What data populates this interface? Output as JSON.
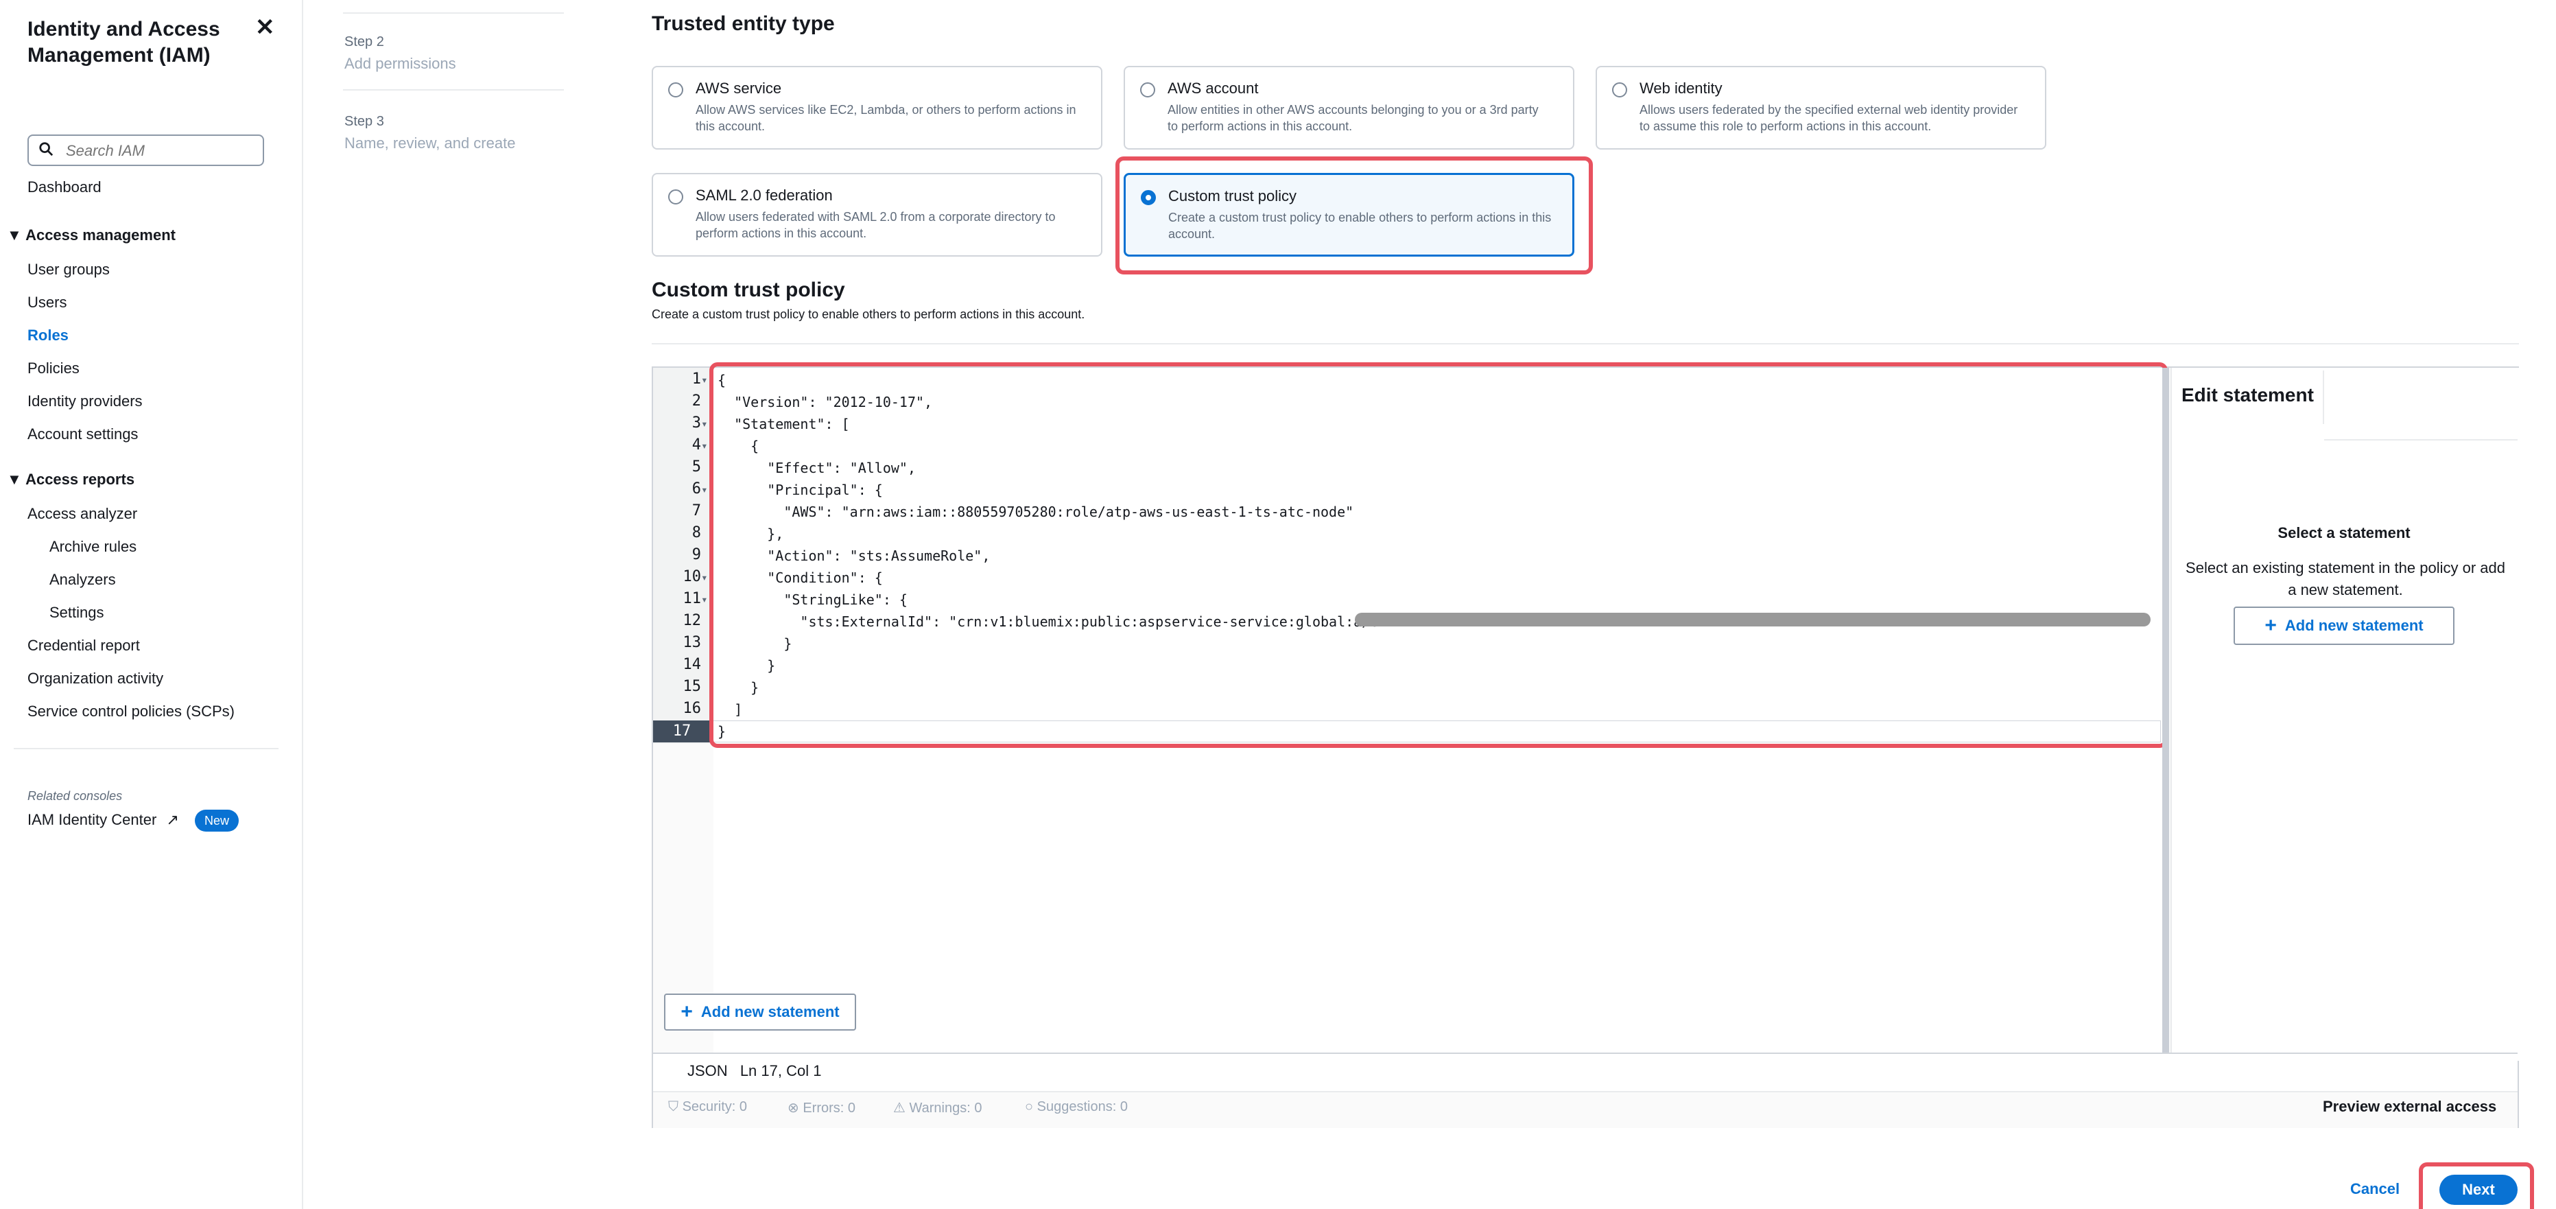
{
  "sidebar": {
    "title": "Identity and Access Management (IAM)",
    "close_icon": "close-icon",
    "search_placeholder": "Search IAM",
    "dashboard": "Dashboard",
    "access_management": {
      "label": "Access management",
      "items": [
        "User groups",
        "Users",
        "Roles",
        "Policies",
        "Identity providers",
        "Account settings"
      ],
      "active": "Roles"
    },
    "access_reports": {
      "label": "Access reports",
      "analyzer": "Access analyzer",
      "analyzer_items": [
        "Archive rules",
        "Analyzers",
        "Settings"
      ],
      "items": [
        "Credential report",
        "Organization activity",
        "Service control policies (SCPs)"
      ]
    },
    "related_consoles": "Related consoles",
    "identity_center": "IAM Identity Center",
    "new_badge": "New"
  },
  "steps": [
    {
      "label": "Step 2",
      "text": "Add permissions"
    },
    {
      "label": "Step 3",
      "text": "Name, review, and create"
    }
  ],
  "trusted_entity": {
    "heading": "Trusted entity type",
    "options": [
      {
        "title": "AWS service",
        "desc": "Allow AWS services like EC2, Lambda, or others to perform actions in this account."
      },
      {
        "title": "AWS account",
        "desc": "Allow entities in other AWS accounts belonging to you or a 3rd party to perform actions in this account."
      },
      {
        "title": "Web identity",
        "desc": "Allows users federated by the specified external web identity provider to assume this role to perform actions in this account."
      },
      {
        "title": "SAML 2.0 federation",
        "desc": "Allow users federated with SAML 2.0 from a corporate directory to perform actions in this account."
      },
      {
        "title": "Custom trust policy",
        "desc": "Create a custom trust policy to enable others to perform actions in this account."
      }
    ],
    "selected": "Custom trust policy"
  },
  "policy": {
    "heading": "Custom trust policy",
    "description": "Create a custom trust policy to enable others to perform actions in this account.",
    "code_lines": [
      "{",
      "  \"Version\": \"2012-10-17\",",
      "  \"Statement\": [",
      "    {",
      "      \"Effect\": \"Allow\",",
      "      \"Principal\": {",
      "        \"AWS\": \"arn:aws:iam::880559705280:role/atp-aws-us-east-1-ts-atc-node\"",
      "      },",
      "      \"Action\": \"sts:AssumeRole\",",
      "      \"Condition\": {",
      "        \"StringLike\": {",
      "          \"sts:ExternalId\": \"crn:v1:bluemix:public:aspservice-service:global:a/e7",
      "        }",
      "      }",
      "    }",
      "  ]",
      "}"
    ],
    "line_numbers": [
      "1",
      "2",
      "3",
      "4",
      "5",
      "6",
      "7",
      "8",
      "9",
      "10",
      "11",
      "12",
      "13",
      "14",
      "15",
      "16",
      "17"
    ],
    "current_line": "17",
    "edit_statement": "Edit statement",
    "select_statement_title": "Select a statement",
    "select_statement_desc": "Select an existing statement in the policy or add a new statement.",
    "add_new_statement": "Add new statement",
    "status_format": "JSON",
    "status_position": "Ln 17, Col 1",
    "checks": [
      "Security: 0",
      "Errors: 0",
      "Warnings: 0",
      "Suggestions: 0"
    ],
    "preview_external_access": "Preview external access"
  },
  "footer": {
    "cancel": "Cancel",
    "next": "Next"
  },
  "colors": {
    "accent": "#0972d3",
    "highlight": "#e8525f"
  }
}
